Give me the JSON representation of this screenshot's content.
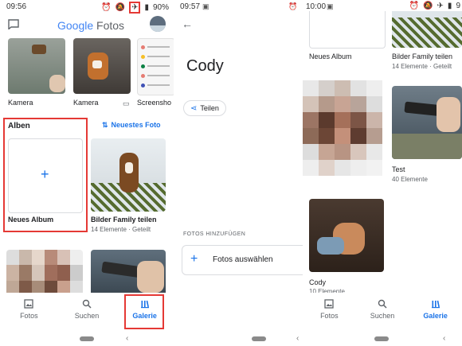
{
  "colors": {
    "accent": "#1a73e8",
    "highlight": "#e53935"
  },
  "panel1": {
    "status": {
      "time": "09:56",
      "battery": "90%"
    },
    "header": {
      "logo_word1": "Google",
      "logo_word2": "Fotos"
    },
    "folders": [
      {
        "label": "Kamera"
      },
      {
        "label": "Kamera"
      },
      {
        "label": "Screensho"
      }
    ],
    "albums": {
      "title": "Alben",
      "newest_link": "Neuestes Foto"
    },
    "album_cards": [
      {
        "title": "Neues Album"
      },
      {
        "title": "Bilder Family teilen",
        "subtitle": "14 Elemente · Geteilt"
      }
    ],
    "nav": [
      {
        "label": "Fotos",
        "icon": "photo-icon"
      },
      {
        "label": "Suchen",
        "icon": "search-icon"
      },
      {
        "label": "Galerie",
        "icon": "library-icon",
        "active": true
      }
    ]
  },
  "panel2": {
    "status": {
      "time": "09:57"
    },
    "album_name": "Cody",
    "share_button": "Teilen",
    "section_label": "FOTOS HINZUFÜGEN",
    "select_photos": "Fotos auswählen"
  },
  "panel3": {
    "status": {
      "time": "10:00",
      "battery": "9"
    },
    "albums": [
      {
        "title": "Neues Album"
      },
      {
        "title": "Bilder Family teilen",
        "subtitle": "14 Elemente · Geteilt"
      },
      {
        "title": "Test",
        "subtitle": "40 Elemente"
      },
      {
        "title": "Cody",
        "subtitle": "10 Elemente"
      }
    ],
    "nav": [
      {
        "label": "Fotos",
        "icon": "photo-icon"
      },
      {
        "label": "Suchen",
        "icon": "search-icon"
      },
      {
        "label": "Galerie",
        "icon": "library-icon",
        "active": true
      }
    ]
  }
}
